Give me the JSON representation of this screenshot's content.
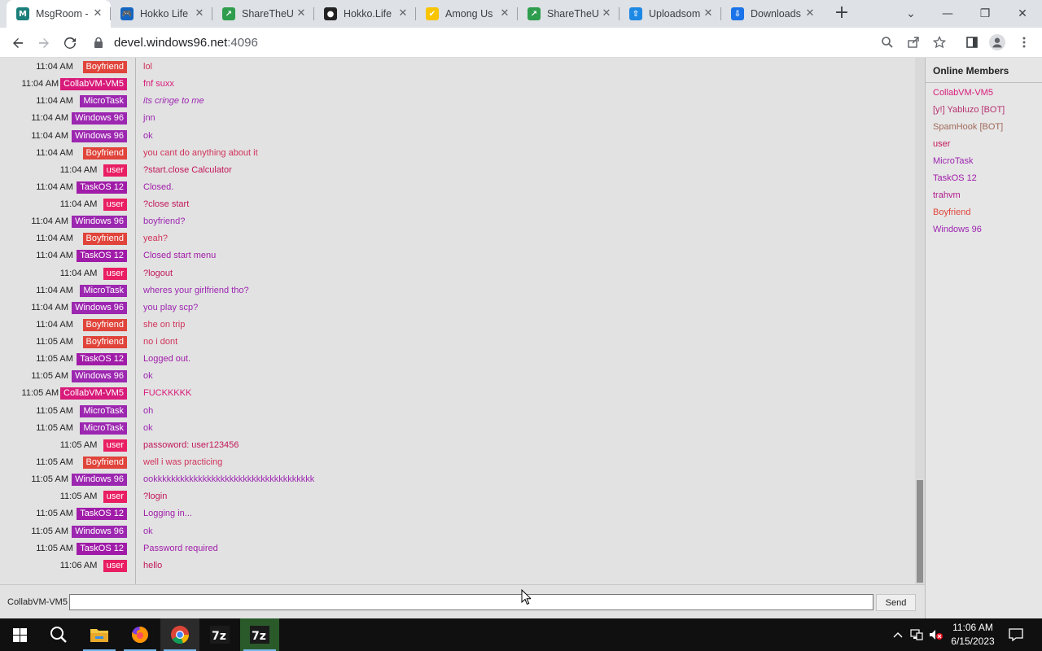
{
  "browser": {
    "tabs": [
      {
        "title": "MsgRoom -",
        "icon": "msgroom-icon",
        "color": "#1a7f7a",
        "glyph": "M"
      },
      {
        "title": "Hokko Life",
        "icon": "gamepad-icon",
        "color": "#1565c0",
        "glyph": "🎮"
      },
      {
        "title": "ShareTheU",
        "icon": "share-icon",
        "color": "#2e9d4e",
        "glyph": "↗"
      },
      {
        "title": "Hokko.Life",
        "icon": "github-icon",
        "color": "#222222",
        "glyph": "●"
      },
      {
        "title": "Among Us",
        "icon": "checkbox-icon",
        "color": "#f9c400",
        "glyph": "✔"
      },
      {
        "title": "ShareTheU",
        "icon": "share-icon",
        "color": "#2e9d4e",
        "glyph": "↗"
      },
      {
        "title": "Uploadsom",
        "icon": "upload-icon",
        "color": "#1e88e5",
        "glyph": "⇧"
      },
      {
        "title": "Downloads",
        "icon": "download-icon",
        "color": "#1a73e8",
        "glyph": "⇩"
      }
    ],
    "url_host": "devel.windows96.net",
    "url_port": ":4096"
  },
  "chat": {
    "messages": [
      {
        "time": "11:04 AM",
        "user": "Boyfriend",
        "text": "lol",
        "ucolor": "#e0443a",
        "tcolor": "#d0325a"
      },
      {
        "time": "11:04 AM",
        "user": "CollabVM-VM5",
        "text": "fnf suxx",
        "ucolor": "#d81b7a",
        "tcolor": "#d81b7a"
      },
      {
        "time": "11:04 AM",
        "user": "MicroTask",
        "text": "its cringe to me",
        "ucolor": "#9c27b0",
        "tcolor": "#9c27b0",
        "italic": true
      },
      {
        "time": "11:04 AM",
        "user": "Windows 96",
        "text": "jnn",
        "ucolor": "#9c27b0",
        "tcolor": "#9c27b0"
      },
      {
        "time": "11:04 AM",
        "user": "Windows 96",
        "text": "ok",
        "ucolor": "#9c27b0",
        "tcolor": "#9c27b0"
      },
      {
        "time": "11:04 AM",
        "user": "Boyfriend",
        "text": "you cant do anything about it",
        "ucolor": "#e0443a",
        "tcolor": "#d0325a"
      },
      {
        "time": "11:04 AM",
        "user": "user",
        "text": "?start.close Calculator",
        "ucolor": "#e91e63",
        "tcolor": "#c2185b"
      },
      {
        "time": "11:04 AM",
        "user": "TaskOS 12",
        "text": "Closed.",
        "ucolor": "#a01ca8",
        "tcolor": "#a01ca8"
      },
      {
        "time": "11:04 AM",
        "user": "user",
        "text": "?close start",
        "ucolor": "#e91e63",
        "tcolor": "#c2185b"
      },
      {
        "time": "11:04 AM",
        "user": "Windows 96",
        "text": "boyfriend?",
        "ucolor": "#9c27b0",
        "tcolor": "#9c27b0"
      },
      {
        "time": "11:04 AM",
        "user": "Boyfriend",
        "text": "yeah?",
        "ucolor": "#e0443a",
        "tcolor": "#d0325a"
      },
      {
        "time": "11:04 AM",
        "user": "TaskOS 12",
        "text": "Closed start menu",
        "ucolor": "#a01ca8",
        "tcolor": "#a01ca8"
      },
      {
        "time": "11:04 AM",
        "user": "user",
        "text": "?logout",
        "ucolor": "#e91e63",
        "tcolor": "#c2185b"
      },
      {
        "time": "11:04 AM",
        "user": "MicroTask",
        "text": "wheres your girlfriend tho?",
        "ucolor": "#9c27b0",
        "tcolor": "#9c27b0"
      },
      {
        "time": "11:04 AM",
        "user": "Windows 96",
        "text": "you play scp?",
        "ucolor": "#9c27b0",
        "tcolor": "#9c27b0"
      },
      {
        "time": "11:04 AM",
        "user": "Boyfriend",
        "text": "she on trip",
        "ucolor": "#e0443a",
        "tcolor": "#d0325a"
      },
      {
        "time": "11:05 AM",
        "user": "Boyfriend",
        "text": "no i dont",
        "ucolor": "#e0443a",
        "tcolor": "#d0325a"
      },
      {
        "time": "11:05 AM",
        "user": "TaskOS 12",
        "text": "Logged out.",
        "ucolor": "#a01ca8",
        "tcolor": "#a01ca8"
      },
      {
        "time": "11:05 AM",
        "user": "Windows 96",
        "text": "ok",
        "ucolor": "#9c27b0",
        "tcolor": "#9c27b0"
      },
      {
        "time": "11:05 AM",
        "user": "CollabVM-VM5",
        "text": "FUCKKKKK",
        "ucolor": "#d81b7a",
        "tcolor": "#d81b7a"
      },
      {
        "time": "11:05 AM",
        "user": "MicroTask",
        "text": "oh",
        "ucolor": "#9c27b0",
        "tcolor": "#9c27b0"
      },
      {
        "time": "11:05 AM",
        "user": "MicroTask",
        "text": "ok",
        "ucolor": "#9c27b0",
        "tcolor": "#9c27b0"
      },
      {
        "time": "11:05 AM",
        "user": "user",
        "text": "passoword: user123456",
        "ucolor": "#e91e63",
        "tcolor": "#c2185b"
      },
      {
        "time": "11:05 AM",
        "user": "Boyfriend",
        "text": "well i was practicing",
        "ucolor": "#e0443a",
        "tcolor": "#d0325a"
      },
      {
        "time": "11:05 AM",
        "user": "Windows 96",
        "text": "ookkkkkkkkkkkkkkkkkkkkkkkkkkkkkkkkkkkk",
        "ucolor": "#9c27b0",
        "tcolor": "#9c27b0"
      },
      {
        "time": "11:05 AM",
        "user": "user",
        "text": "?login",
        "ucolor": "#e91e63",
        "tcolor": "#c2185b"
      },
      {
        "time": "11:05 AM",
        "user": "TaskOS 12",
        "text": "Logging in...",
        "ucolor": "#a01ca8",
        "tcolor": "#a01ca8"
      },
      {
        "time": "11:05 AM",
        "user": "Windows 96",
        "text": "ok",
        "ucolor": "#9c27b0",
        "tcolor": "#9c27b0"
      },
      {
        "time": "11:05 AM",
        "user": "TaskOS 12",
        "text": "Password required",
        "ucolor": "#a01ca8",
        "tcolor": "#a01ca8"
      },
      {
        "time": "11:06 AM",
        "user": "user",
        "text": "hello",
        "ucolor": "#e91e63",
        "tcolor": "#c2185b"
      }
    ],
    "current_nick": "CollabVM-VM5",
    "send_label": "Send"
  },
  "members": {
    "title": "Online Members",
    "list": [
      {
        "name": "CollabVM-VM5",
        "color": "#d81b7a"
      },
      {
        "name": "[y!] Yabluzo [BOT]",
        "color": "#b5306f"
      },
      {
        "name": "SpamHook [BOT]",
        "color": "#a06a5a"
      },
      {
        "name": "user",
        "color": "#c2185b"
      },
      {
        "name": "MicroTask",
        "color": "#9c27b0"
      },
      {
        "name": "TaskOS 12",
        "color": "#a01ca8"
      },
      {
        "name": "trahvm",
        "color": "#b01c8c"
      },
      {
        "name": "Boyfriend",
        "color": "#e0443a"
      },
      {
        "name": "Windows 96",
        "color": "#9c27b0"
      }
    ]
  },
  "taskbar": {
    "apps": [
      "file-explorer-icon",
      "firefox-icon",
      "chrome-icon",
      "7zip-icon",
      "7zip-fm-icon"
    ],
    "time": "11:06 AM",
    "date": "6/15/2023"
  }
}
